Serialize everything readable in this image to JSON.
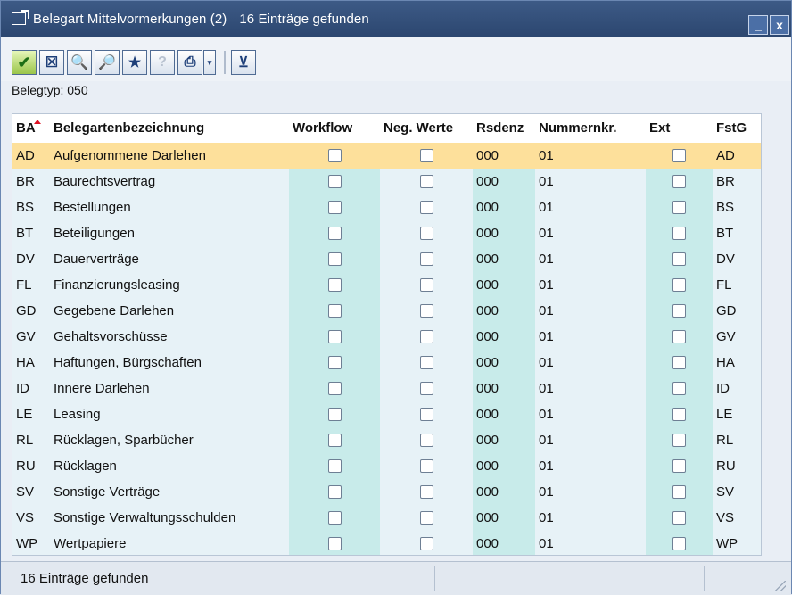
{
  "window": {
    "title": "Belegart Mittelvormerkungen (2)",
    "count_text": "16 Einträge gefunden",
    "minimize_glyph": "_",
    "close_glyph": "x"
  },
  "toolbar": {
    "buttons": [
      {
        "icon": "checkmark-icon",
        "glyph": "✔"
      },
      {
        "icon": "close-box-icon",
        "glyph": "☒"
      },
      {
        "icon": "find-icon",
        "glyph": "🔍"
      },
      {
        "icon": "find-next-icon",
        "glyph": "🔎"
      },
      {
        "icon": "favorite-add-icon",
        "glyph": "★"
      },
      {
        "icon": "help-icon",
        "glyph": "?"
      },
      {
        "icon": "print-icon",
        "glyph": "⎙"
      },
      {
        "icon": "dropdown-icon",
        "glyph": "▾"
      },
      {
        "icon": "filter-icon",
        "glyph": "⊻"
      }
    ]
  },
  "header_line": "Belegtyp: 050",
  "table": {
    "columns": [
      "BA",
      "Belegartenbezeichnung",
      "Workflow",
      "Neg. Werte",
      "Rsdenz",
      "Nummernkr.",
      "Ext",
      "FstG"
    ],
    "rows": [
      {
        "ba": "AD",
        "bez": "Aufgenommene Darlehen",
        "rs": "000",
        "nr": "01",
        "fst": "AD",
        "selected": true
      },
      {
        "ba": "BR",
        "bez": "Baurechtsvertrag",
        "rs": "000",
        "nr": "01",
        "fst": "BR"
      },
      {
        "ba": "BS",
        "bez": "Bestellungen",
        "rs": "000",
        "nr": "01",
        "fst": "BS"
      },
      {
        "ba": "BT",
        "bez": "Beteiligungen",
        "rs": "000",
        "nr": "01",
        "fst": "BT"
      },
      {
        "ba": "DV",
        "bez": "Dauerverträge",
        "rs": "000",
        "nr": "01",
        "fst": "DV"
      },
      {
        "ba": "FL",
        "bez": "Finanzierungsleasing",
        "rs": "000",
        "nr": "01",
        "fst": "FL"
      },
      {
        "ba": "GD",
        "bez": "Gegebene Darlehen",
        "rs": "000",
        "nr": "01",
        "fst": "GD"
      },
      {
        "ba": "GV",
        "bez": "Gehaltsvorschüsse",
        "rs": "000",
        "nr": "01",
        "fst": "GV"
      },
      {
        "ba": "HA",
        "bez": "Haftungen, Bürgschaften",
        "rs": "000",
        "nr": "01",
        "fst": "HA"
      },
      {
        "ba": "ID",
        "bez": "Innere Darlehen",
        "rs": "000",
        "nr": "01",
        "fst": "ID"
      },
      {
        "ba": "LE",
        "bez": "Leasing",
        "rs": "000",
        "nr": "01",
        "fst": "LE"
      },
      {
        "ba": "RL",
        "bez": "Rücklagen, Sparbücher",
        "rs": "000",
        "nr": "01",
        "fst": "RL"
      },
      {
        "ba": "RU",
        "bez": "Rücklagen",
        "rs": "000",
        "nr": "01",
        "fst": "RU"
      },
      {
        "ba": "SV",
        "bez": "Sonstige Verträge",
        "rs": "000",
        "nr": "01",
        "fst": "SV"
      },
      {
        "ba": "VS",
        "bez": "Sonstige Verwaltungsschulden",
        "rs": "000",
        "nr": "01",
        "fst": "VS"
      },
      {
        "ba": "WP",
        "bez": "Wertpapiere",
        "rs": "000",
        "nr": "01",
        "fst": "WP"
      }
    ]
  },
  "statusbar": {
    "message": "16 Einträge gefunden"
  },
  "colors": {
    "title_bg": "#2c4770",
    "selected_row": "#fde09b",
    "teal_column": "#c8ebea",
    "light_column": "#e7f2f7"
  }
}
